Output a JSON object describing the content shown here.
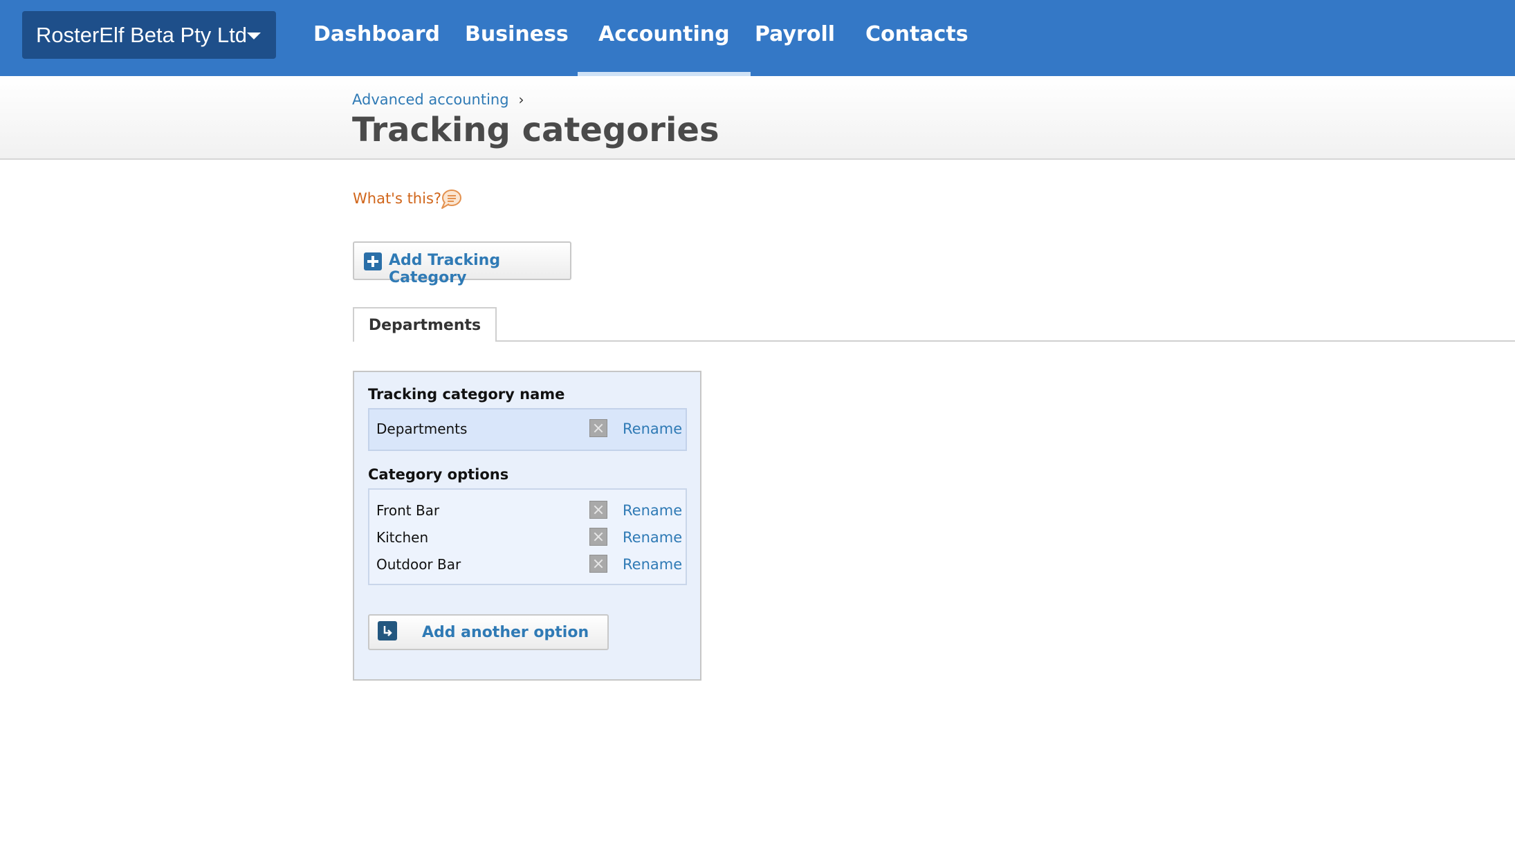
{
  "org": {
    "name": "RosterElf Beta Pty Ltd"
  },
  "nav": {
    "items": [
      {
        "label": "Dashboard"
      },
      {
        "label": "Business"
      },
      {
        "label": "Accounting"
      },
      {
        "label": "Payroll"
      },
      {
        "label": "Contacts"
      }
    ],
    "active": "Accounting"
  },
  "header": {
    "breadcrumb": "Advanced accounting",
    "breadcrumb_sep": "›",
    "title": "Tracking categories"
  },
  "help": {
    "label": "What's this?"
  },
  "add_category_button": {
    "label": "Add Tracking Category"
  },
  "tabs": [
    {
      "label": "Departments"
    }
  ],
  "panel": {
    "name_label": "Tracking category name",
    "name_value": "Departments",
    "rename_label": "Rename",
    "options_label": "Category options",
    "options": [
      {
        "label": "Front Bar"
      },
      {
        "label": "Kitchen"
      },
      {
        "label": "Outdoor Bar"
      }
    ],
    "add_option_label": "Add another option"
  },
  "colors": {
    "nav_bg": "#3478c6",
    "org_bg": "#1e4f8a",
    "link": "#2f7ab5",
    "help": "#d0651a",
    "panel_bg": "#e9f0fb"
  }
}
